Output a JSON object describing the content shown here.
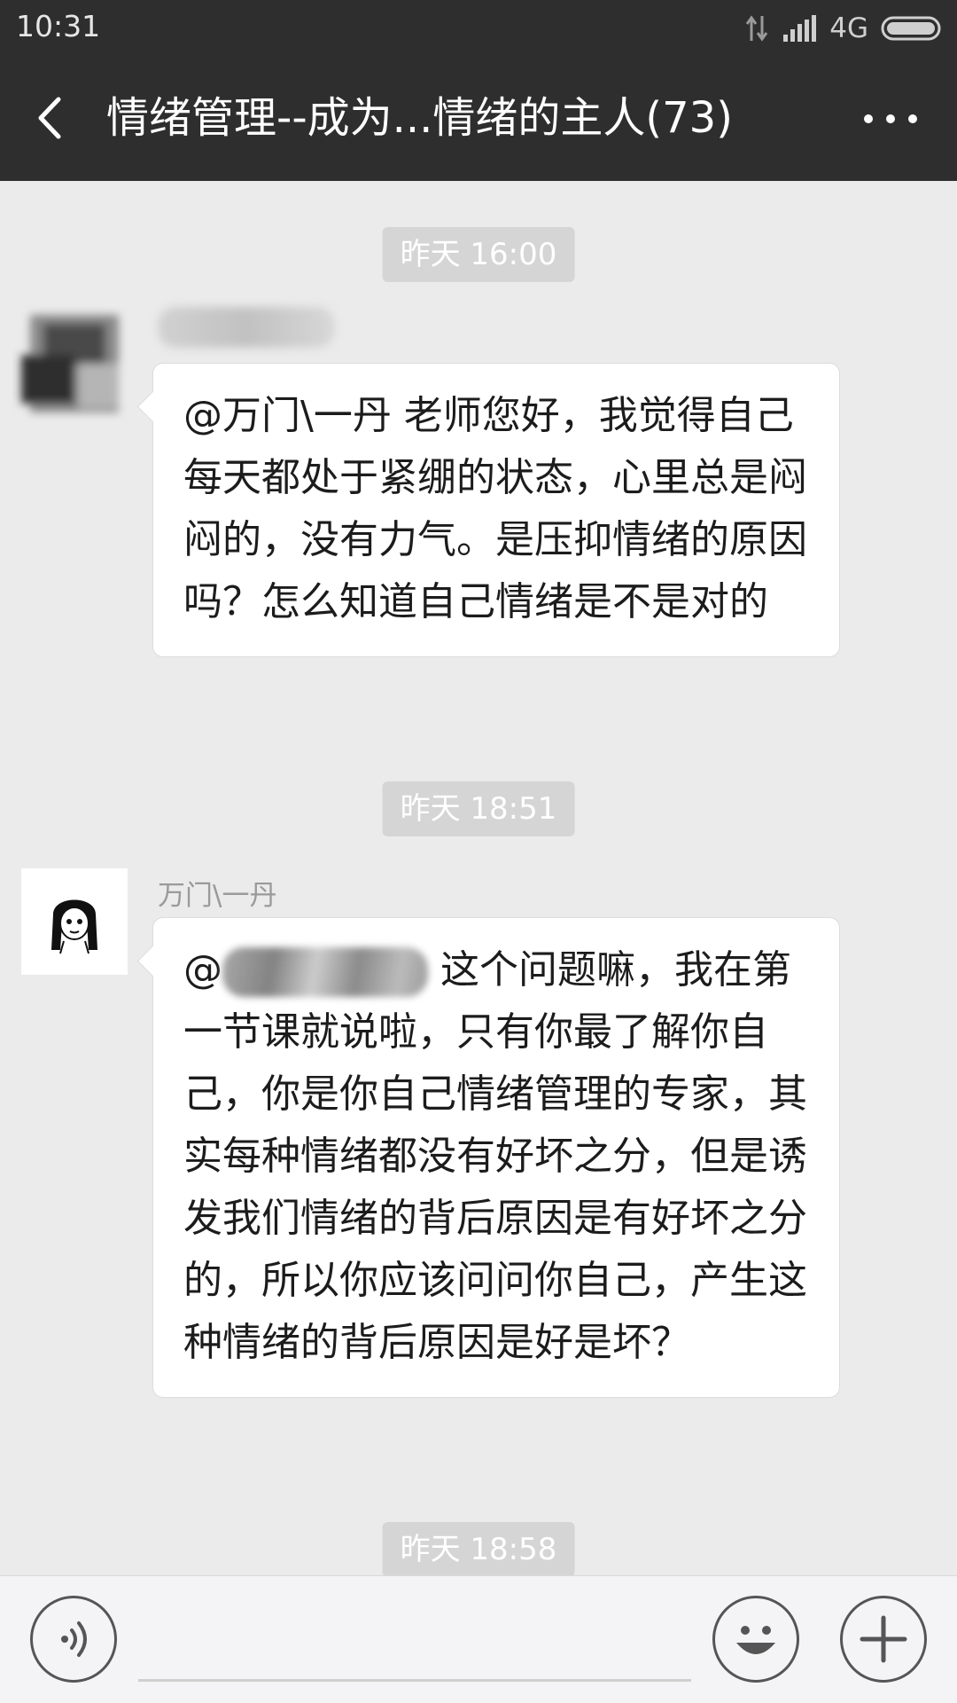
{
  "status_bar": {
    "time": "10:31",
    "network": "4G"
  },
  "header": {
    "title": "情绪管理--成为...情绪的主人(73)"
  },
  "messages": [
    {
      "timestamp": "昨天 16:00",
      "sender": "",
      "text": "@万门\\一丹  老师您好，我觉得自己每天都处于紧绷的状态，心里总是闷闷的，没有力气。是压抑情绪的原因吗？怎么知道自己情绪是不是对的"
    },
    {
      "timestamp": "昨天 18:51",
      "sender": "万门\\一丹",
      "mention_prefix": "@",
      "text": " 这个问题嘛，我在第一节课就说啦，只有你最了解你自己，你是你自己情绪管理的专家，其实每种情绪都没有好坏之分，但是诱发我们情绪的背后原因是有好坏之分的，所以你应该问问你自己，产生这种情绪的背后原因是好是坏？"
    },
    {
      "timestamp": "昨天 18:58"
    }
  ],
  "icons": {
    "back": "back-arrow-icon",
    "more": "more-dots-icon",
    "voice": "voice-icon",
    "emoji": "emoji-icon",
    "plus": "plus-icon"
  },
  "colors": {
    "header_bg": "#2e2e2e",
    "chat_bg": "#ebebeb",
    "bubble_bg": "#ffffff",
    "time_chip_bg": "#d5d5d5"
  }
}
